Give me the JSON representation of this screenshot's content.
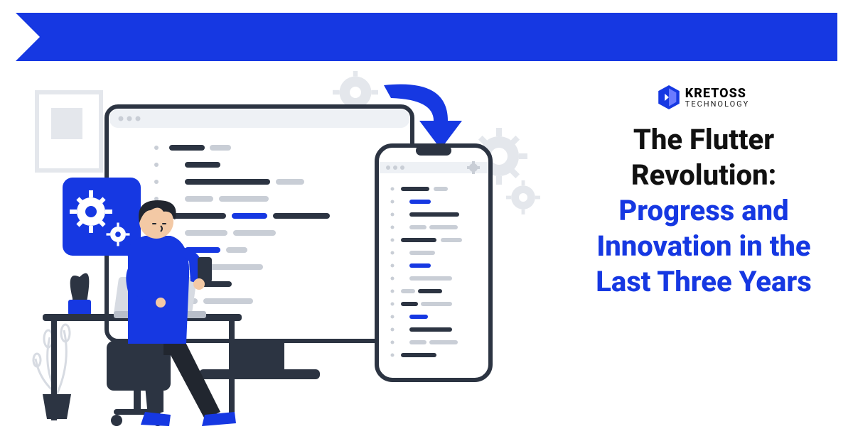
{
  "brand": {
    "name": "KRETOSS",
    "tagline": "TECHNOLOGY"
  },
  "title": {
    "part1": "The Flutter Revolution:",
    "part2": "Progress and Innovation in the Last Three Years"
  },
  "colors": {
    "primary": "#1638E2",
    "dark": "#2C3442",
    "gray": "#C9CED6"
  }
}
